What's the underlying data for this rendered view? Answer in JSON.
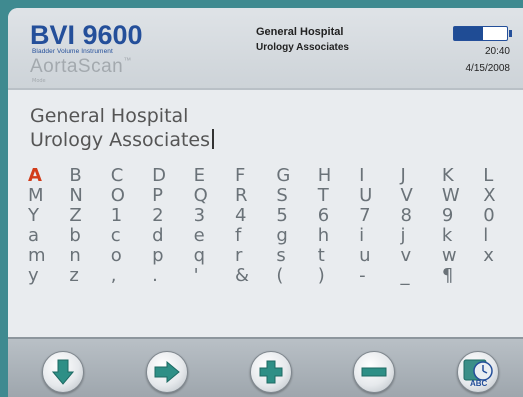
{
  "header": {
    "product_title": "BVI 9600",
    "product_subtitle": "Bladder Volume Instrument",
    "brand": "AortaScan",
    "brand_tm": "™",
    "mode_label": "Mode",
    "clinic_line1": "General Hospital",
    "clinic_line2": "Urology Associates",
    "battery_level_fraction": 0.55,
    "time": "20:40",
    "date": "4/15/2008"
  },
  "entry": {
    "line1": "General Hospital",
    "line2": "Urology Associates"
  },
  "keyboard": {
    "rows": [
      [
        "A",
        "B",
        "C",
        "D",
        "E",
        "F",
        "G",
        "H",
        "I",
        "J",
        "K",
        "L"
      ],
      [
        "M",
        "N",
        "O",
        "P",
        "Q",
        "R",
        "S",
        "T",
        "U",
        "V",
        "W",
        "X"
      ],
      [
        "Y",
        "Z",
        "1",
        "2",
        "3",
        "4",
        "5",
        "6",
        "7",
        "8",
        "9",
        "0"
      ],
      [
        "a",
        "b",
        "c",
        "d",
        "e",
        "f",
        "g",
        "h",
        "i",
        "j",
        "k",
        "l"
      ],
      [
        "m",
        "n",
        "o",
        "p",
        "q",
        "r",
        "s",
        "t",
        "u",
        "v",
        "w",
        "x"
      ],
      [
        "y",
        "z",
        ",",
        ".",
        "'",
        "&",
        "(",
        ")",
        "-",
        "_",
        "¶",
        ""
      ]
    ],
    "selected_key": "A"
  },
  "toolbar": {
    "buttons": [
      {
        "name": "down-button",
        "icon": "arrow-down-icon"
      },
      {
        "name": "right-button",
        "icon": "arrow-right-icon"
      },
      {
        "name": "plus-button",
        "icon": "plus-icon"
      },
      {
        "name": "minus-button",
        "icon": "minus-icon"
      },
      {
        "name": "abc-button",
        "icon": "abc-clock-icon",
        "label": "ABC"
      }
    ]
  },
  "colors": {
    "accent": "#244f9a",
    "selected_key": "#d23c1a",
    "button_icon": "#2e8f86"
  }
}
